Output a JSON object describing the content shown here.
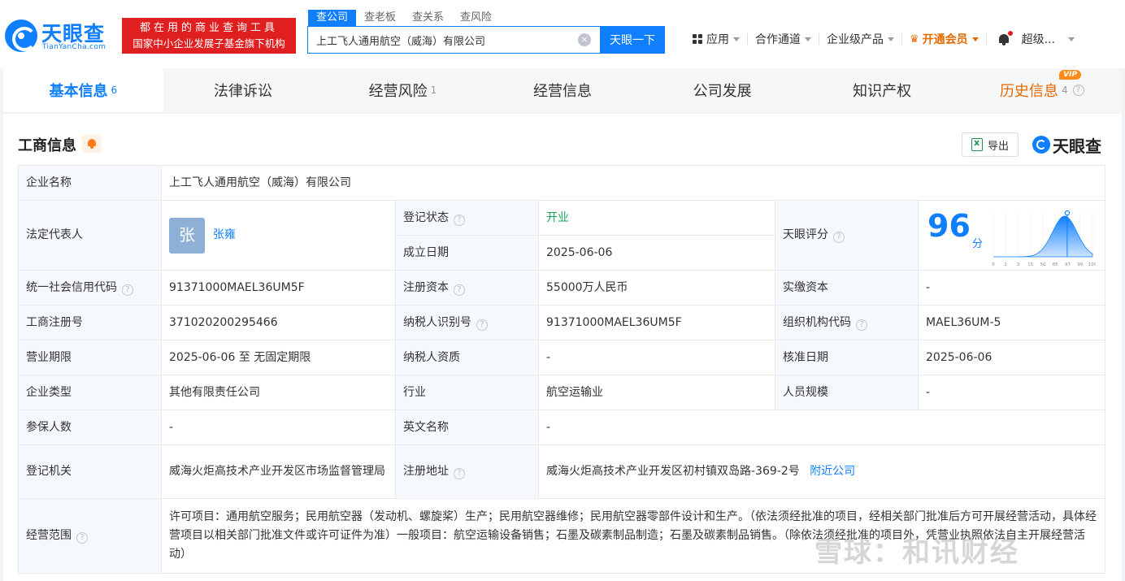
{
  "header": {
    "logo_text": "天眼查",
    "logo_sub": "TianYanCha.com",
    "slogan_line1": "都在用的商业查询工具",
    "slogan_line2": "国家中小企业发展子基金旗下机构",
    "search_tabs": [
      "查公司",
      "查老板",
      "查关系",
      "查风险"
    ],
    "search_value": "上工飞人通用航空（威海）有限公司",
    "search_button": "天眼一下",
    "nav": {
      "apps": "应用",
      "channel": "合作通道",
      "enterprise": "企业级产品",
      "vip": "开通会员",
      "user": "超级..."
    }
  },
  "tabs": [
    {
      "label": "基本信息",
      "count": "6"
    },
    {
      "label": "法律诉讼",
      "count": ""
    },
    {
      "label": "经营风险",
      "count": "1"
    },
    {
      "label": "经营信息",
      "count": ""
    },
    {
      "label": "公司发展",
      "count": ""
    },
    {
      "label": "知识产权",
      "count": ""
    },
    {
      "label": "历史信息",
      "count": "4",
      "badge": "VIP"
    }
  ],
  "section": {
    "title": "工商信息",
    "export": "导出",
    "brand": "天眼查"
  },
  "info": {
    "company_name_label": "企业名称",
    "company_name": "上工飞人通用航空（威海）有限公司",
    "legal_rep_label": "法定代表人",
    "legal_rep_avatar": "张",
    "legal_rep": "张雍",
    "reg_status_label": "登记状态",
    "reg_status": "开业",
    "found_date_label": "成立日期",
    "found_date": "2025-06-06",
    "score_label": "天眼评分",
    "score": "96",
    "score_unit": "分",
    "credit_code_label": "统一社会信用代码",
    "credit_code": "91371000MAEL36UM5F",
    "reg_capital_label": "注册资本",
    "reg_capital": "55000万人民币",
    "paid_capital_label": "实缴资本",
    "paid_capital": "-",
    "reg_no_label": "工商注册号",
    "reg_no": "371020200295466",
    "taxpayer_id_label": "纳税人识别号",
    "taxpayer_id": "91371000MAEL36UM5F",
    "org_code_label": "组织机构代码",
    "org_code": "MAEL36UM-5",
    "term_label": "营业期限",
    "term": "2025-06-06 至 无固定期限",
    "tax_qual_label": "纳税人资质",
    "tax_qual": "-",
    "approve_date_label": "核准日期",
    "approve_date": "2025-06-06",
    "type_label": "企业类型",
    "type": "其他有限责任公司",
    "industry_label": "行业",
    "industry": "航空运输业",
    "staff_label": "人员规模",
    "staff": "-",
    "insured_label": "参保人数",
    "insured": "-",
    "en_name_label": "英文名称",
    "en_name": "-",
    "authority_label": "登记机关",
    "authority": "威海火炬高技术产业开发区市场监督管理局",
    "address_label": "注册地址",
    "address": "威海火炬高技术产业开发区初村镇双岛路-369-2号",
    "nearby": "附近公司",
    "scope_label": "经营范围",
    "scope": "许可项目：通用航空服务；民用航空器（发动机、螺旋桨）生产；民用航空器维修；民用航空器零部件设计和生产。（依法须经批准的项目，经相关部门批准后方可开展经营活动，具体经营项目以相关部门批准文件或许可证件为准）一般项目：航空运输设备销售；石墨及碳素制品制造；石墨及碳素制品销售。（除依法须经批准的项目外，凭营业执照依法自主开展经营活动）"
  },
  "score_chart": {
    "type": "area",
    "x": [
      "0",
      "1",
      "3",
      "15",
      "50",
      "85",
      "97",
      "99",
      "100"
    ],
    "marker": 96,
    "color": "#0f7fff"
  },
  "watermark": "雪球：和讯财经"
}
